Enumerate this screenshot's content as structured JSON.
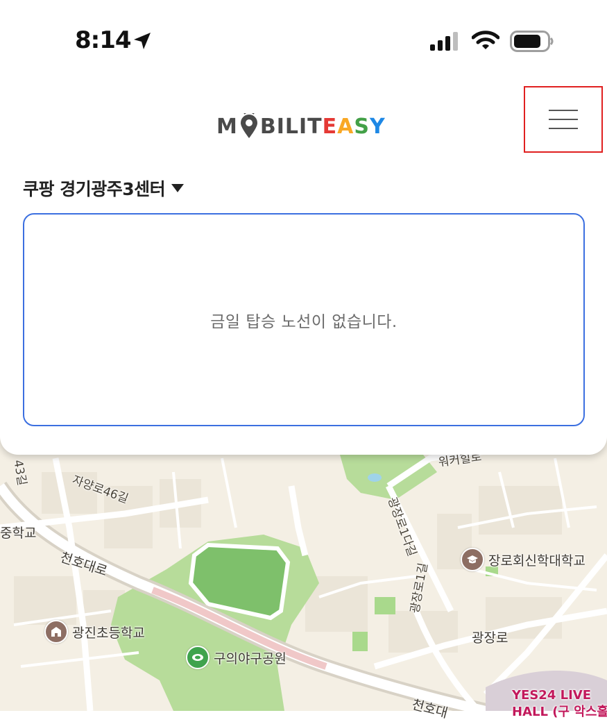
{
  "status_bar": {
    "time": "8:14",
    "icons": [
      "location-arrow-icon",
      "cellular-signal-icon",
      "wifi-icon",
      "battery-icon"
    ]
  },
  "header": {
    "logo_dark": "M",
    "logo_dark2": "BILIT",
    "logo_color_letters": [
      "E",
      "A",
      "S",
      "Y"
    ],
    "logo_colors": [
      "#e53935",
      "#f9a825",
      "#43a047",
      "#1e88e5"
    ],
    "menu_icon": "hamburger-menu-icon",
    "highlight_color": "#e02020"
  },
  "route_panel": {
    "center_name": "쿠팡 경기광주3센터",
    "dropdown_icon": "caret-down-icon",
    "empty_message": "금일 탑승 노선이 없습니다.",
    "accent_color": "#3b6fe0"
  },
  "map": {
    "labels": {
      "r43": "43길",
      "jayang46": "자양로46길",
      "middle_school": "중학교",
      "cheonho1": "천호대로",
      "cheonho2": "천호대",
      "gwangjang1da": "광장로1다길",
      "gwangjang1": "광장로1길",
      "gwangjang": "광장로",
      "ahcha": "워커힐로"
    },
    "pois": {
      "seminary": "장로회신학대학교",
      "gwangjin_elem": "광진초등학교",
      "baseball_park": "구의야구공원",
      "yes24_line1": "YES24 LIVE",
      "yes24_line2": "HALL (구 악스홀)"
    }
  }
}
